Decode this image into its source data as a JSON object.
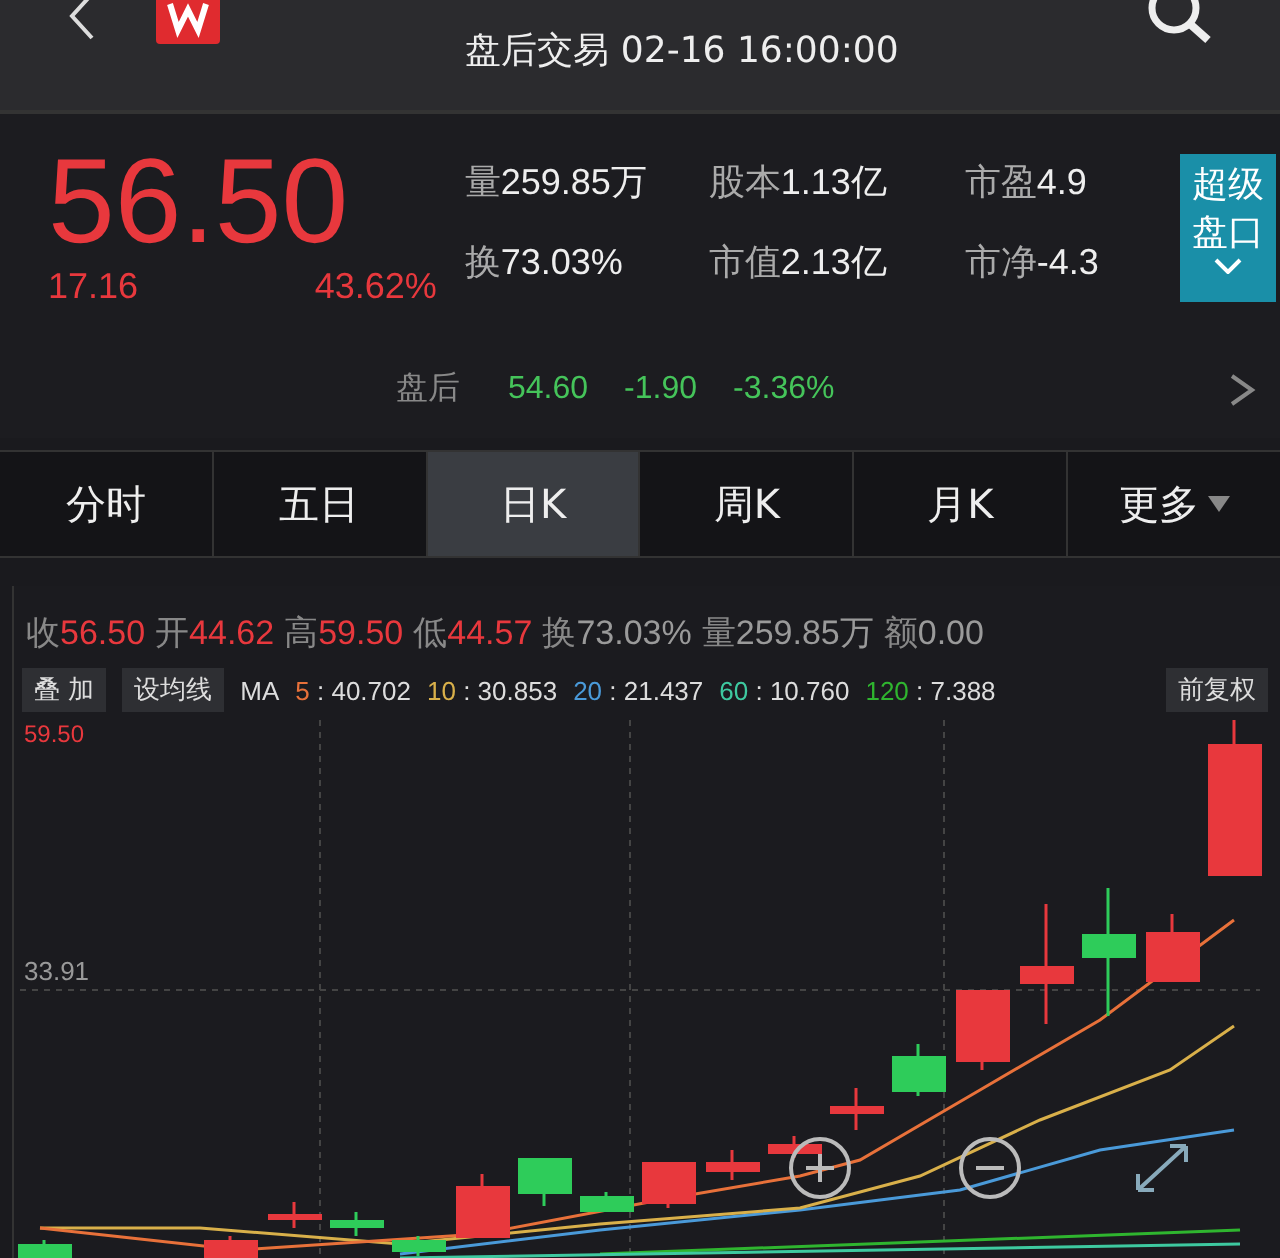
{
  "header": {
    "subtitle": "盘后交易 02-16 16:00:00"
  },
  "quote": {
    "price": "56.50",
    "change": "17.16",
    "change_pct": "43.62%",
    "stats": [
      {
        "label": "量",
        "value": "259.85万"
      },
      {
        "label": "股本",
        "value": "1.13亿"
      },
      {
        "label": "市盈",
        "value": "4.9"
      },
      {
        "label": "换",
        "value": "73.03%"
      },
      {
        "label": "市值",
        "value": "2.13亿"
      },
      {
        "label": "市净",
        "value": "-4.3"
      }
    ],
    "panel_button": "超级盘口",
    "after_hours": {
      "label": "盘后",
      "price": "54.60",
      "change": "-1.90",
      "change_pct": "-3.36%"
    }
  },
  "tabs": [
    {
      "label": "分时",
      "selected": false
    },
    {
      "label": "五日",
      "selected": false
    },
    {
      "label": "日K",
      "selected": true
    },
    {
      "label": "周K",
      "selected": false
    },
    {
      "label": "月K",
      "selected": false
    },
    {
      "label": "更多",
      "selected": false
    }
  ],
  "ohlc": [
    {
      "label": "收",
      "value": "56.50",
      "color": "#e8383d"
    },
    {
      "label": "开",
      "value": "44.62",
      "color": "#e8383d"
    },
    {
      "label": "高",
      "value": "59.50",
      "color": "#e8383d"
    },
    {
      "label": "低",
      "value": "44.57",
      "color": "#e8383d"
    },
    {
      "label": "换",
      "value": "73.03%",
      "color": "#9a9a9a"
    },
    {
      "label": "量",
      "value": "259.85万",
      "color": "#9a9a9a"
    },
    {
      "label": "额",
      "value": "0.00",
      "color": "#9a9a9a"
    }
  ],
  "chart_toolbar": {
    "overlay_button": "叠 加",
    "ma_button": "设均线",
    "ma_label": "MA",
    "adjust_button": "前复权",
    "ma": [
      {
        "period": "5",
        "value": ": 40.702",
        "color": "#e8713a"
      },
      {
        "period": "10",
        "value": ": 30.853",
        "color": "#d9b04a"
      },
      {
        "period": "20",
        "value": ": 21.437",
        "color": "#4a9ad9"
      },
      {
        "period": "60",
        "value": ": 10.760",
        "color": "#3ec9a0"
      },
      {
        "period": "120",
        "value": ": 7.388",
        "color": "#2fb52f"
      }
    ]
  },
  "chart": {
    "top_label": "59.50",
    "mid_label": "33.91"
  }
}
